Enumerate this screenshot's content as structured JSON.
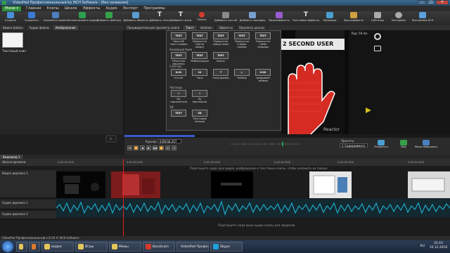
{
  "window": {
    "title": "VideoPad Профессиональный by NCH Software - [без названия]",
    "controls": [
      "–",
      "□",
      "✕"
    ]
  },
  "menubar": {
    "menu_button": "Меню ▾",
    "items": [
      "Главная",
      "Клипы",
      "Шкала",
      "Эффекты",
      "Аудио",
      "Экспорт",
      "Программы"
    ]
  },
  "toolbar": {
    "items": [
      {
        "label": "Открыть",
        "icon": "open-icon",
        "color": "#4a90d9"
      },
      {
        "label": "Сохранить",
        "icon": "save-icon",
        "color": "#3a7bd5"
      },
      {
        "label": "Сохранить проект",
        "icon": "save-project-icon",
        "color": "#4a80c0"
      },
      {
        "label": "Экспортировать видео",
        "icon": "export-video-icon",
        "color": "#2e9e4f"
      },
      {
        "label": "Добавить файл(ы)",
        "icon": "add-file-icon",
        "color": "#36a34a"
      },
      {
        "label": "Добавить объекты",
        "icon": "add-objects-icon",
        "color": "#5a9bd4"
      },
      {
        "label": "Добавить текст",
        "icon": "add-text-icon",
        "color": "#dddddd"
      },
      {
        "label": "Добавить титры",
        "icon": "add-title-icon",
        "color": "#dddddd"
      },
      {
        "label": "Запись",
        "icon": "record-icon",
        "color": "#d33a2c"
      },
      {
        "label": "Добавить пустой",
        "icon": "add-blank-icon",
        "color": "#8a8a8a"
      },
      {
        "label": "Добавить закладку",
        "icon": "add-bookmark-icon",
        "color": "#7aa0d0"
      },
      {
        "label": "Видеоэффекты",
        "icon": "video-effects-icon",
        "color": "#9a5bd0"
      },
      {
        "label": "Текстовые эффекты",
        "icon": "text-effects-icon",
        "color": "#dddddd"
      },
      {
        "label": "Переходы",
        "icon": "transitions-icon",
        "color": "#4aa0d0"
      },
      {
        "label": "Звукоэффекты",
        "icon": "audio-effects-icon",
        "color": "#d0a040"
      },
      {
        "label": "Субтитры",
        "icon": "subtitles-icon",
        "color": "#aaaaaa"
      },
      {
        "label": "Настройки",
        "icon": "settings-icon",
        "color": "#aaaaaa"
      },
      {
        "label": "Программы NCH",
        "icon": "nch-suite-icon",
        "color": "#5aa0e0"
      }
    ]
  },
  "bin": {
    "tabs": [
      "Видео файлы",
      "Аудио файлы",
      "Изображения"
    ],
    "clip_label": "Текстовый клип"
  },
  "preview": {
    "tabs": [
      "Предварительный просмотр клипа",
      "Текст",
      "Шаблон",
      "Эффекты",
      "Просмотр шкалы"
    ],
    "fps_label": "Руд: 50 ms",
    "overlay_text": "2 SECOND USER",
    "footer_text": "Reactor"
  },
  "dropdown": {
    "sections": [
      "Анимация букв",
      "Счётчик",
      "Частицы",
      "3D"
    ],
    "rows": [
      [
        {
          "thumb": "TEXT",
          "label": "Простой текст поверх"
        },
        {
          "thumb": "TEXT",
          "label": "Прокрутка текста сверху"
        },
        {
          "thumb": "TEXT",
          "label": "Прокрутка сверху вниз"
        },
        {
          "thumb": "TEXT",
          "label": "Прокрутка справа налево"
        },
        {
          "thumb": "TEXT",
          "label": "Прокрутка слева направо"
        }
      ],
      [
        {
          "thumb": "TEXT",
          "label": "Печатная машинка"
        },
        {
          "thumb": "TEXT",
          "label": "Мобилизация"
        },
        {
          "thumb": "TEXT",
          "label": "Волна"
        }
      ],
      [
        {
          "thumb": "0:01",
          "label": "Отсчёт"
        },
        {
          "thumb": "12",
          "label": "Часы"
        },
        {
          "thumb": "7",
          "label": "Секундомер"
        },
        {
          "thumb": "◴",
          "label": "Таймер"
        },
        {
          "thumb": "0:00",
          "label": "Цифровой таймер"
        }
      ],
      [
        {
          "thumb": "✦",
          "label": "По горизонтали"
        },
        {
          "thumb": "✦",
          "label": "По вертикали"
        }
      ],
      [
        {
          "thumb": "TEXT",
          "label": ""
        },
        {
          "thumb": "3D",
          "label": "Текстовые плашки"
        }
      ]
    ]
  },
  "transport": {
    "cursor_label": "Курсор:",
    "cursor_value": "0:00:04.257",
    "preset_label": "Пресеты:",
    "preset_value": "С Содержимого",
    "buttons": [
      "⏮",
      "⏪",
      "◀",
      "▶",
      "▶▶",
      "⏩",
      "⏭",
      "↺"
    ],
    "right_buttons": [
      {
        "label": "Разделить",
        "icon": "split-icon",
        "color": "#4aa0d0"
      },
      {
        "label": "Вид",
        "icon": "view-icon",
        "color": "#36a34a"
      },
      {
        "label": "Масштабировать",
        "icon": "scale-icon",
        "color": "#4a80c0"
      }
    ]
  },
  "timeline": {
    "tab": "Видеоряд 1",
    "ruler_label": "Шкала времени",
    "ruler_ticks": [
      "0:00:00.000",
      "0:01:00.000",
      "0:02:00.000",
      "0:03:00.000",
      "0:04:00.000",
      "0:05:00.000"
    ],
    "video_track": "Видео дорожка 1",
    "audio_track": "Аудио дорожка 1",
    "audio_track_2": "Аудио дорожка 2",
    "drop_hint_video": "Перетащите сюда свое видео, изображения и текстовые клипы, чтобы наложить их поверх",
    "drop_hint_audio": "Перетащите сюда ваши аудио клипы для сведения"
  },
  "status": {
    "text": "VideoPad Профессиональный v 8.10 © NCH Software"
  },
  "taskbar": {
    "items": [
      {
        "label": "",
        "icon": "explorer-icon",
        "color": "#e6c65a"
      },
      {
        "label": "",
        "icon": "firefox-icon",
        "color": "#e07b2c"
      },
      {
        "label": "видео",
        "icon": "folder-icon",
        "color": "#e6c65a"
      },
      {
        "label": "Игры",
        "icon": "folder-icon",
        "color": "#e6c65a"
      },
      {
        "label": "Мемы",
        "icon": "folder-icon",
        "color": "#e6c65a"
      },
      {
        "label": "Bandicam",
        "icon": "bandicam-icon",
        "color": "#d33a2c"
      },
      {
        "label": "VideoPad Профе...",
        "icon": "videopad-icon",
        "color": "#2e9e4f"
      },
      {
        "label": "Skype",
        "icon": "skype-icon",
        "color": "#1fa1e0"
      }
    ],
    "lang": "RU",
    "time": "22:43",
    "date": "10.12.2018"
  }
}
